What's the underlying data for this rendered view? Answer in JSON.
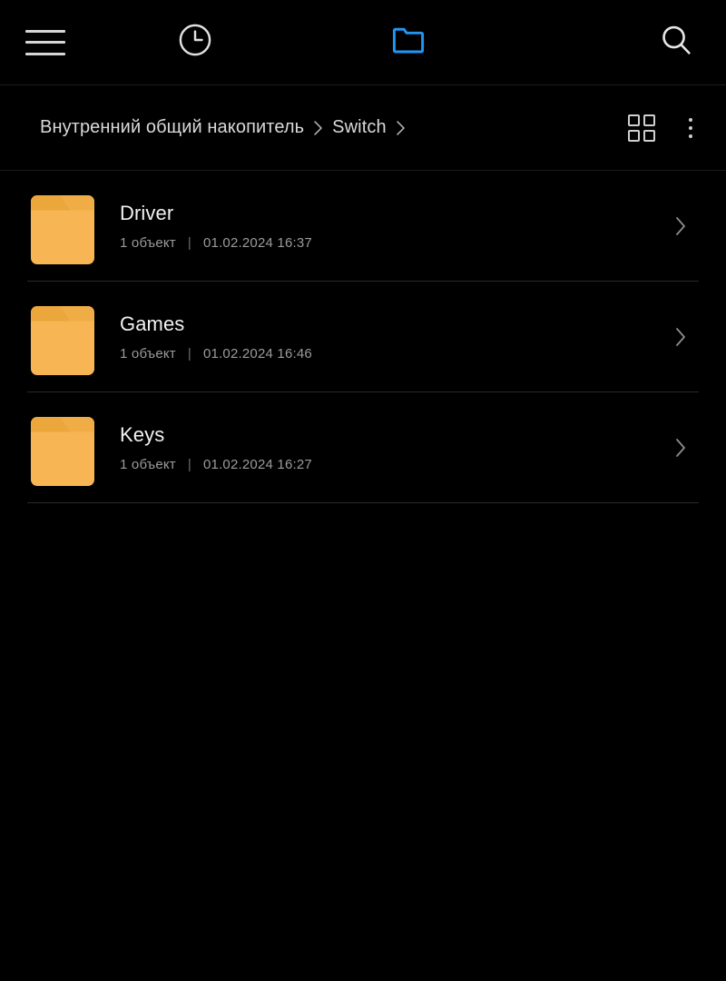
{
  "theme": {
    "background": "#000000",
    "accent_folder_tab_color": "#2196f3",
    "folder_color": "#f7b653",
    "folder_tab_color": "#eba63c",
    "text_primary": "#f2f2f2",
    "text_secondary": "#9b9b9b",
    "divider": "#2a2a2a"
  },
  "toolbar": {
    "menu_icon": "hamburger-menu-icon",
    "recent_icon": "clock-icon",
    "files_icon": "folder-icon",
    "search_icon": "search-icon",
    "active_tab": "files"
  },
  "breadcrumb": {
    "separator": "›",
    "segments": [
      {
        "label": "Внутренний общий накопитель"
      },
      {
        "label": "Switch"
      }
    ],
    "actions": {
      "view_toggle_icon": "grid-view-icon",
      "overflow_icon": "more-options-icon"
    }
  },
  "file_list": {
    "items": [
      {
        "name": "Driver",
        "count": "1 объект",
        "separator": "|",
        "modified": "01.02.2024 16:37",
        "icon": "folder-icon",
        "chevron": "chevron-right-icon"
      },
      {
        "name": "Games",
        "count": "1 объект",
        "separator": "|",
        "modified": "01.02.2024 16:46",
        "icon": "folder-icon",
        "chevron": "chevron-right-icon"
      },
      {
        "name": "Keys",
        "count": "1 объект",
        "separator": "|",
        "modified": "01.02.2024 16:27",
        "icon": "folder-icon",
        "chevron": "chevron-right-icon"
      }
    ]
  }
}
